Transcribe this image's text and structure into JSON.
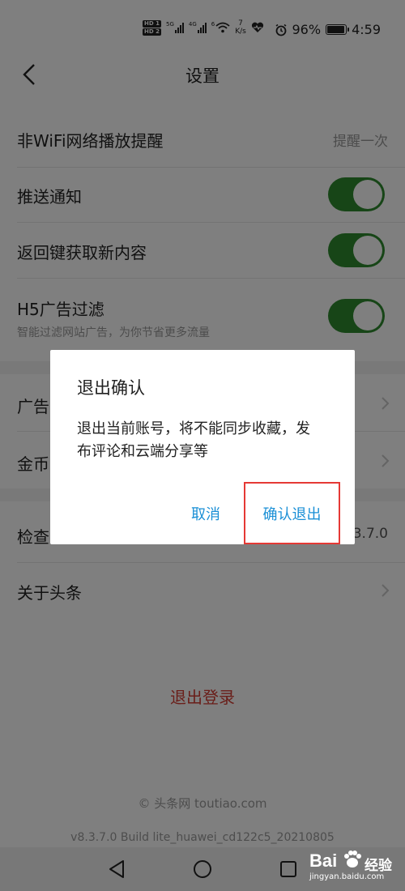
{
  "status_bar": {
    "hd1": "HD 1",
    "hd2": "HD 2",
    "net1": "5G",
    "net2": "4G",
    "wifi_sub": "6",
    "speed_value": "7",
    "speed_unit": "K/s",
    "battery_percent": "96%",
    "battery_level": 0.96,
    "time": "4:59"
  },
  "header": {
    "title": "设置"
  },
  "settings": {
    "wifi_reminder_label": "非WiFi网络播放提醒",
    "wifi_reminder_value": "提醒一次",
    "push_label": "推送通知",
    "push_on": true,
    "back_refresh_label": "返回键获取新内容",
    "back_refresh_on": true,
    "h5_filter_label": "H5广告过滤",
    "h5_filter_sub": "智能过滤网站广告，为你节省更多流量",
    "h5_filter_on": true,
    "ad_label": "广告",
    "coin_label": "金币",
    "check_label": "检查",
    "check_value": "3.7.0",
    "about_label": "关于头条"
  },
  "logout_label": "退出登录",
  "footer": {
    "copyright": "© 头条网 toutiao.com",
    "build": "v8.3.7.0 Build lite_huawei_cd122c5_20210805"
  },
  "dialog": {
    "title": "退出确认",
    "message": "退出当前账号，将不能同步收藏，发布评论和云端分享等",
    "cancel": "取消",
    "confirm": "确认退出"
  },
  "watermark": {
    "brand": "Bai",
    "name": "经验",
    "url": "jingyan.baidu.com"
  },
  "colors": {
    "toggle_on": "#2e8b2e",
    "logout": "#d43c33",
    "dialog_button": "#1a8fd6",
    "highlight_box": "#e53935"
  }
}
